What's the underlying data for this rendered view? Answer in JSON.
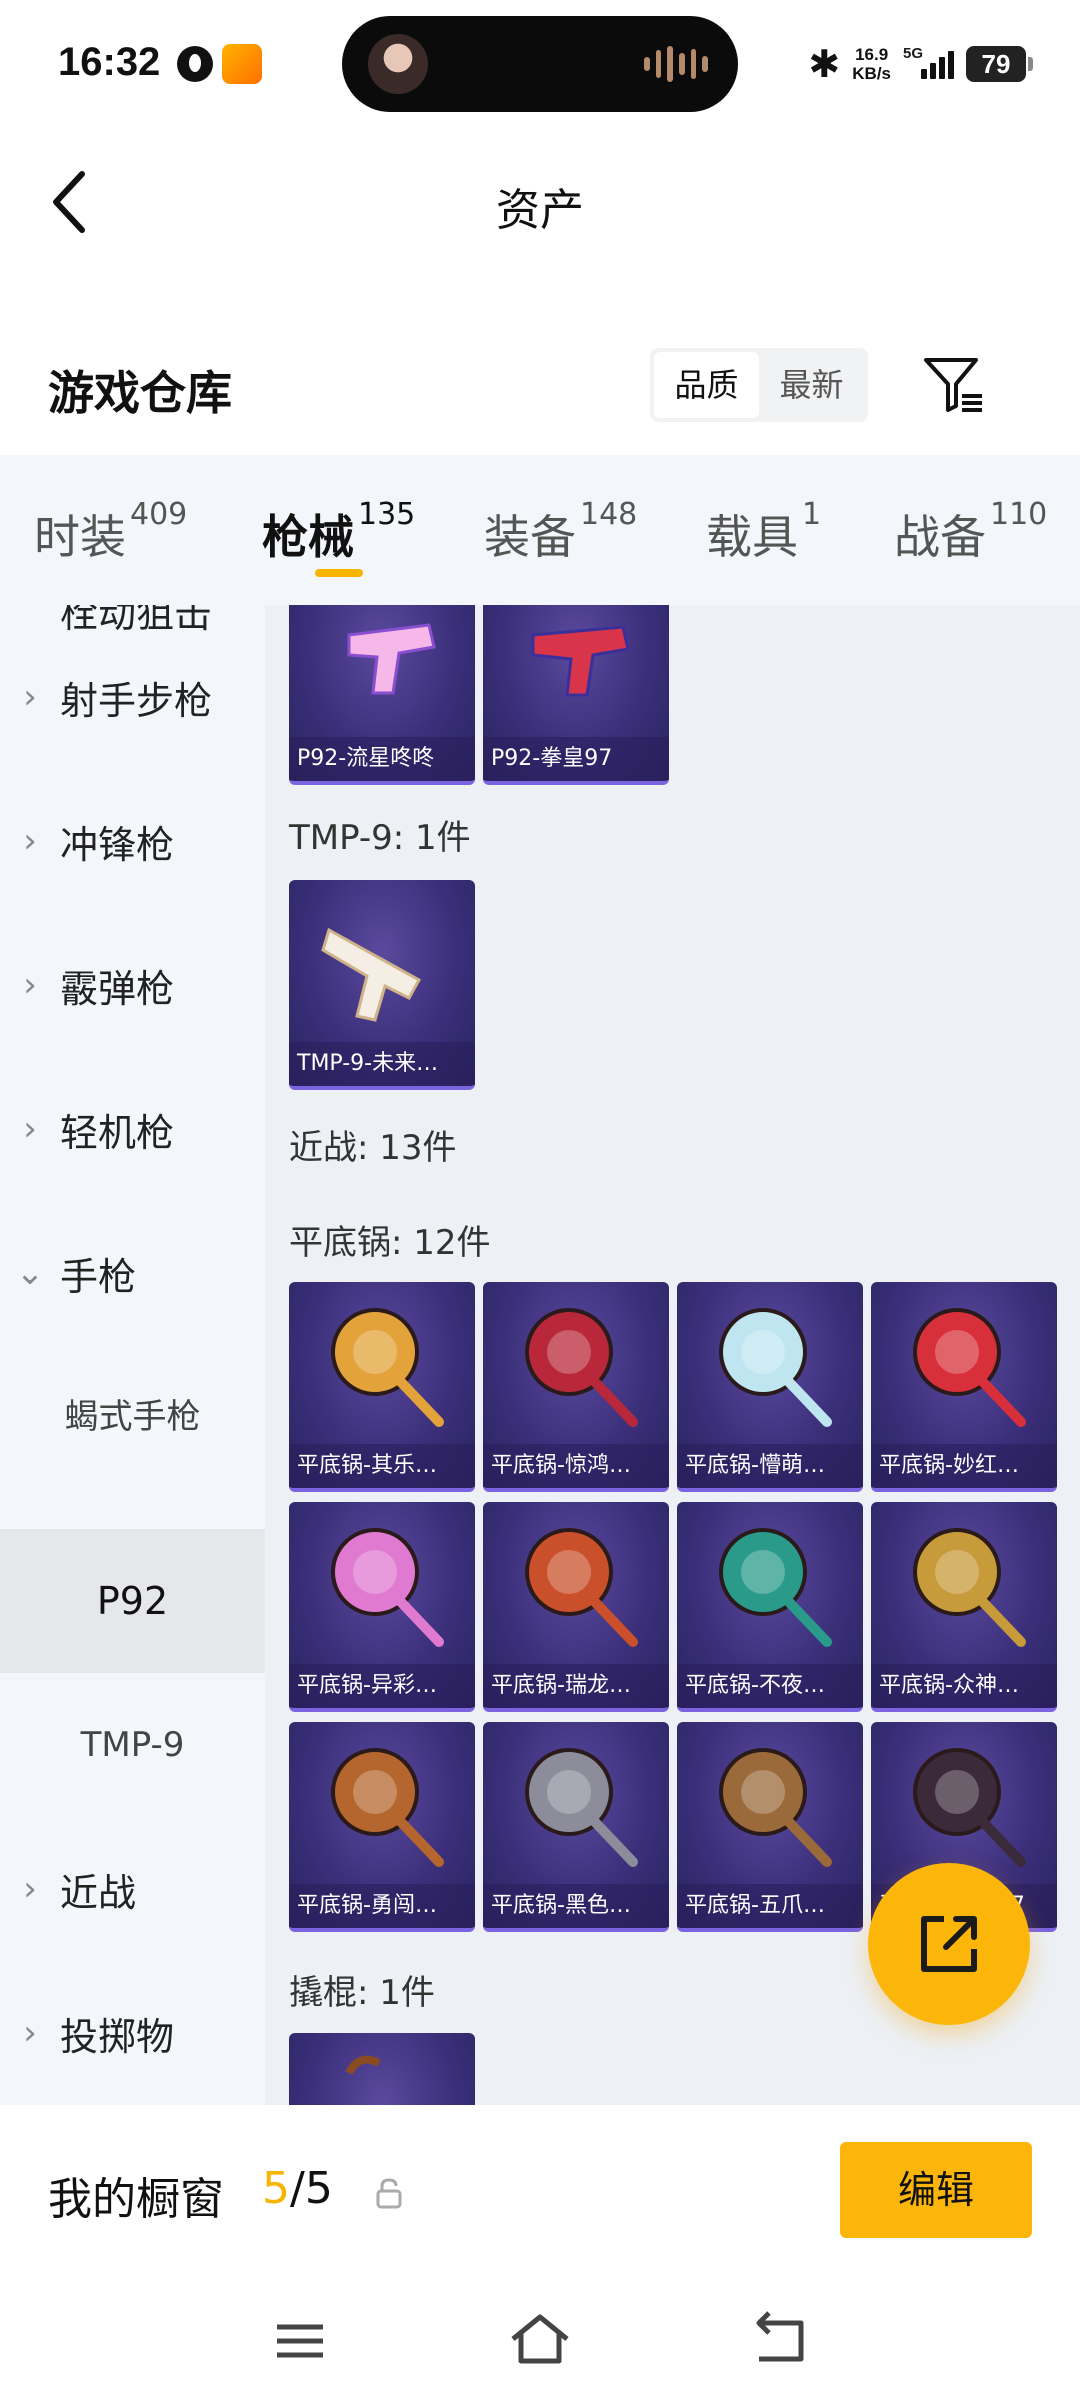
{
  "status_bar": {
    "time": "16:32",
    "net_speed_value": "16.9",
    "net_speed_unit": "KB/s",
    "network": "5G",
    "battery": "79"
  },
  "header": {
    "title": "资产",
    "back_icon": "chevron-left-icon"
  },
  "warehouse": {
    "title": "游戏仓库",
    "sort_options": [
      "品质",
      "最新"
    ],
    "sort_selected": "品质",
    "filter_icon": "filter-icon"
  },
  "tabs": [
    {
      "label": "时装",
      "count": "409"
    },
    {
      "label": "枪械",
      "count": "135",
      "active": true
    },
    {
      "label": "装备",
      "count": "148"
    },
    {
      "label": "载具",
      "count": "1"
    },
    {
      "label": "战备",
      "count": "110"
    }
  ],
  "sidebar": {
    "cut_label": "栓动狙击",
    "items": [
      {
        "label": "射手步枪",
        "expanded": false
      },
      {
        "label": "冲锋枪",
        "expanded": false
      },
      {
        "label": "霰弹枪",
        "expanded": false
      },
      {
        "label": "轻机枪",
        "expanded": false
      },
      {
        "label": "手枪",
        "expanded": true
      }
    ],
    "subitems": [
      {
        "label": "蝎式手枪"
      },
      {
        "label": "P92",
        "active": true
      },
      {
        "label": "TMP-9"
      }
    ],
    "items_after": [
      {
        "label": "近战"
      },
      {
        "label": "投掷物"
      }
    ]
  },
  "content": {
    "p92_items": [
      "P92-流星咚咚",
      "P92-拳皇97"
    ],
    "tmp9_title": "TMP-9: 1件",
    "tmp9_items": [
      "TMP-9-未来…"
    ],
    "melee_title": "近战: 13件",
    "pan_title": "平底锅: 12件",
    "pan_items": [
      "平底锅-其乐…",
      "平底锅-惊鸿…",
      "平底锅-懵萌…",
      "平底锅-妙红…",
      "平底锅-异彩…",
      "平底锅-瑞龙…",
      "平底锅-不夜…",
      "平底锅-众神…",
      "平底锅-勇闯…",
      "平底锅-黑色…",
      "平底锅-五爪…",
      "平底锅-拳皇97"
    ],
    "crowbar_title": "撬棍: 1件"
  },
  "bottom_bar": {
    "label": "我的橱窗",
    "count_used": "5",
    "count_sep": "/5",
    "edit_label": "编辑"
  },
  "colors": {
    "accent": "#fcb60a",
    "card_bg": "#3b2f7a",
    "sidebar_bg": "#f3f6fa"
  }
}
